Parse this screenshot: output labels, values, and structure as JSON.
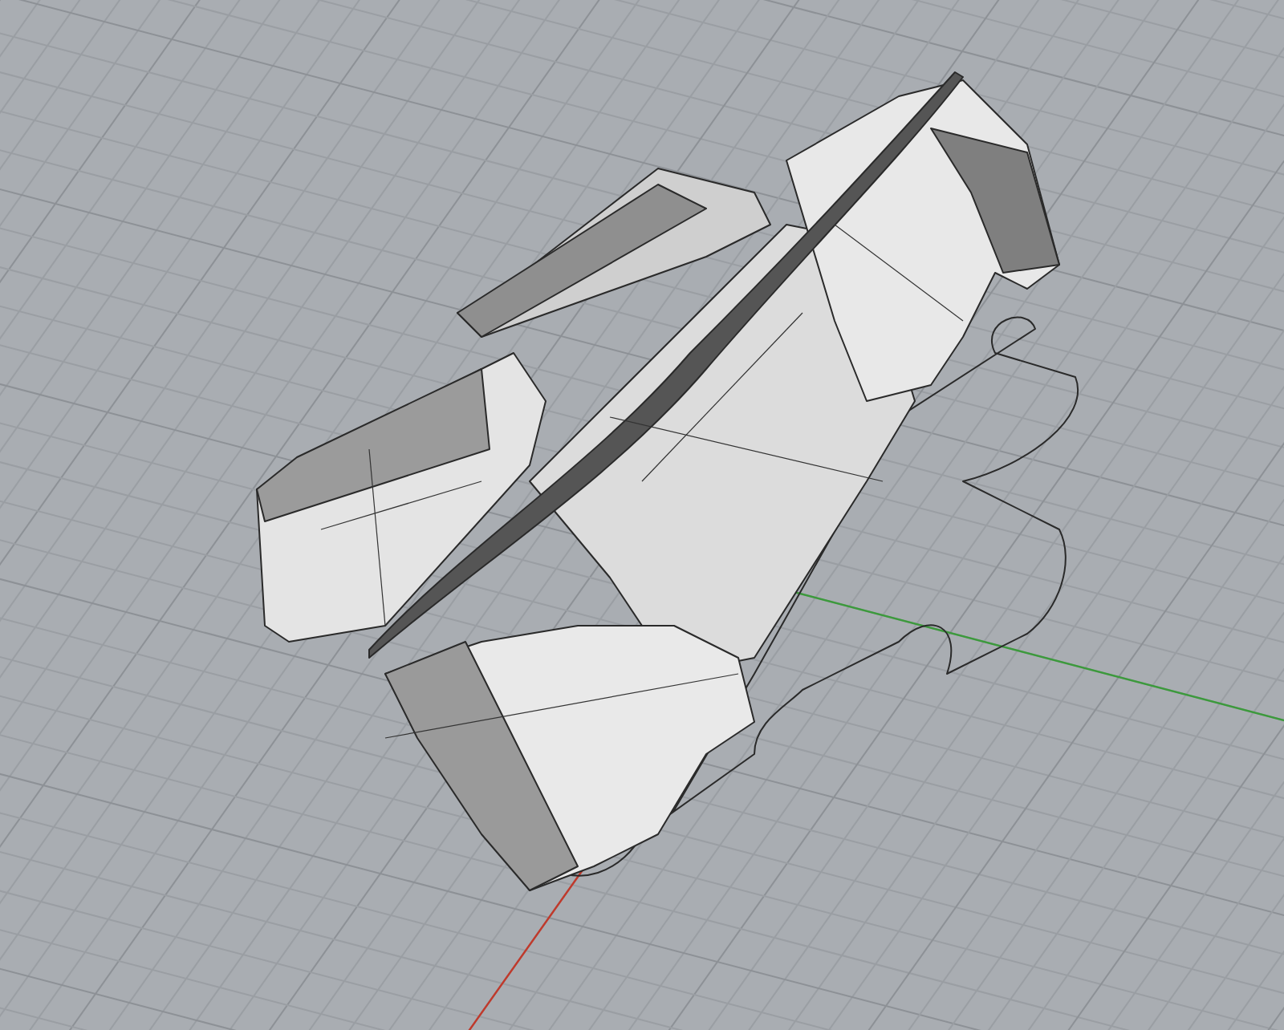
{
  "viewport": {
    "axes": [
      {
        "kind": "x",
        "color": "#c0392b"
      },
      {
        "kind": "y",
        "color": "#3c9a3c"
      }
    ]
  }
}
